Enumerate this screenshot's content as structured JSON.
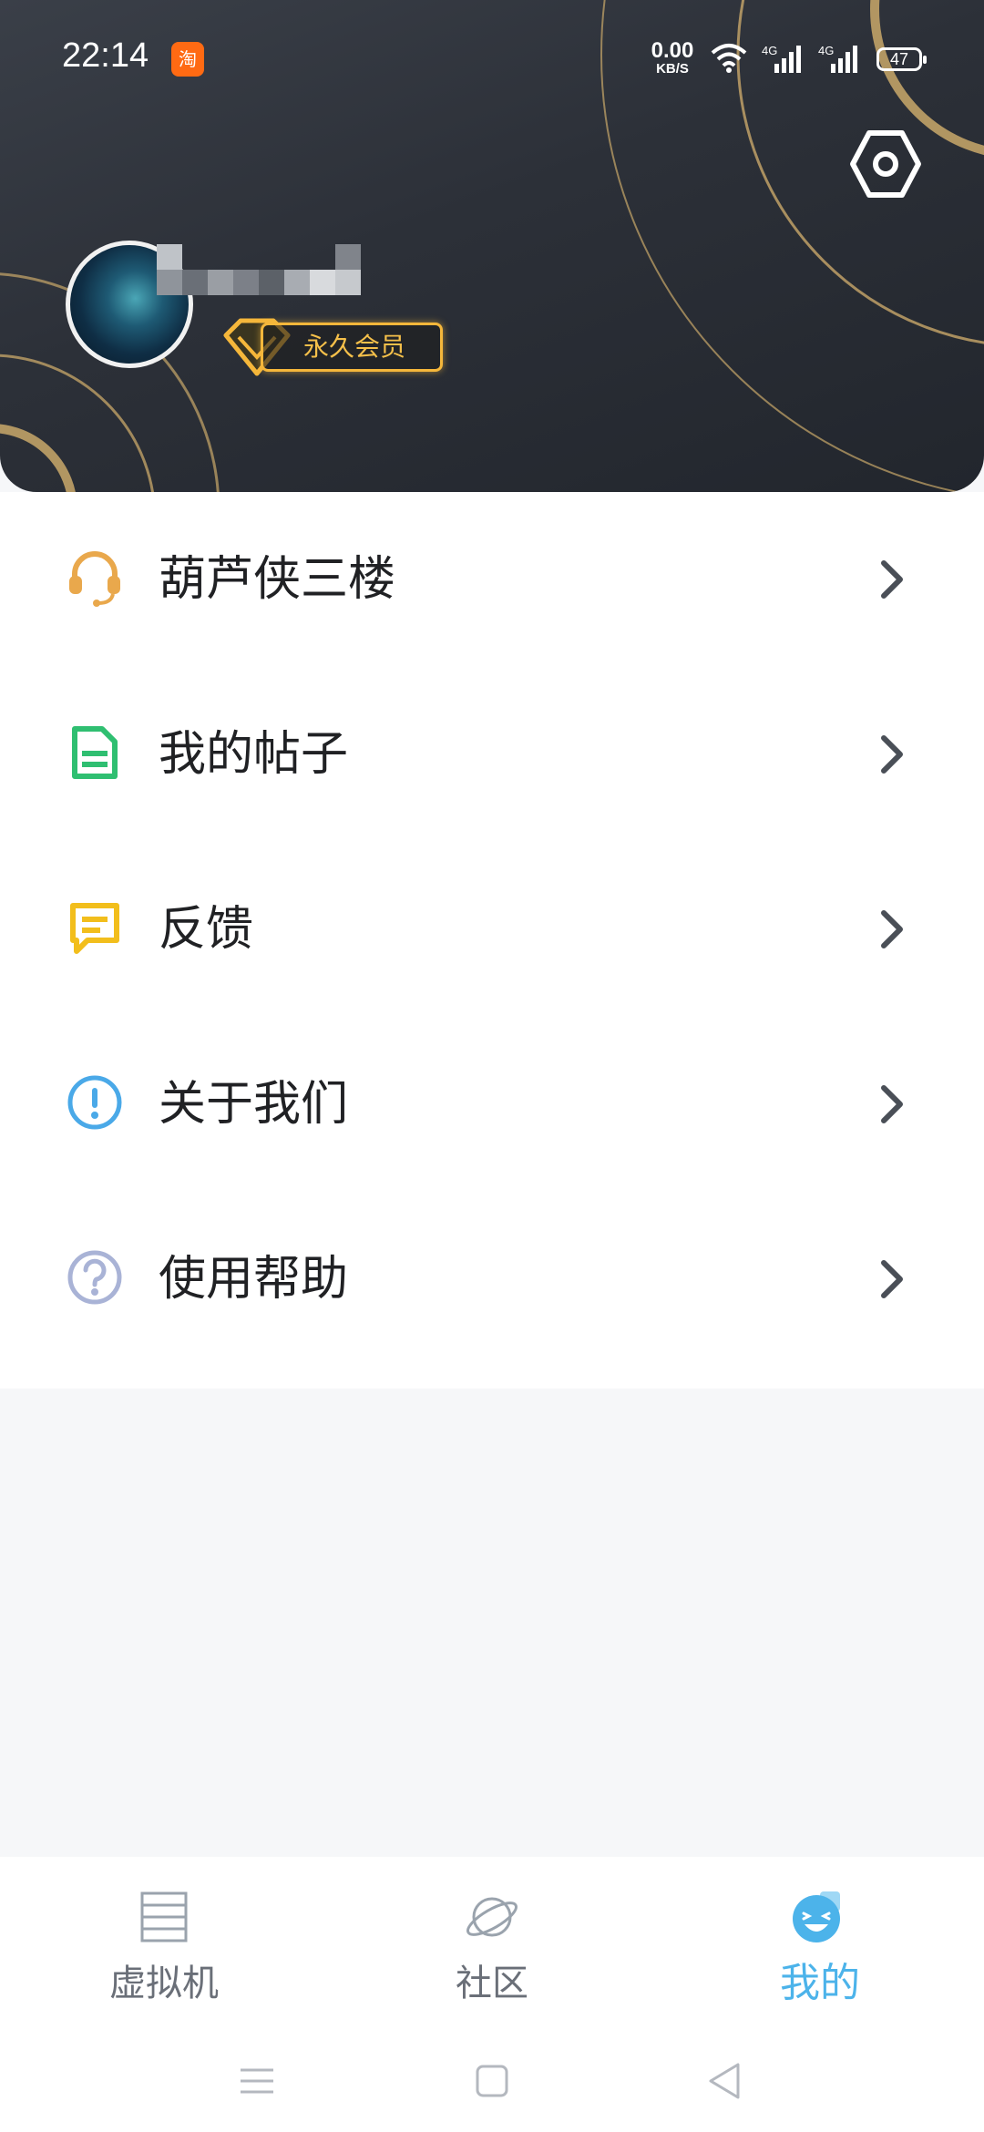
{
  "status_bar": {
    "time": "22:14",
    "app_badge": "淘",
    "net_speed_value": "0.00",
    "net_speed_unit": "KB/S",
    "signal_1": "4G",
    "signal_2": "4G",
    "battery": "47"
  },
  "profile": {
    "vip_label": "永久会员"
  },
  "menu": {
    "items": [
      {
        "label": "葫芦侠三楼",
        "icon": "headset-icon",
        "color": "#e9a84c"
      },
      {
        "label": "我的帖子",
        "icon": "document-icon",
        "color": "#2fbf71"
      },
      {
        "label": "反馈",
        "icon": "message-icon",
        "color": "#f2be1c"
      },
      {
        "label": "关于我们",
        "icon": "info-icon",
        "color": "#4aa9e8"
      },
      {
        "label": "使用帮助",
        "icon": "help-icon",
        "color": "#a9b3d6"
      }
    ]
  },
  "bottom_nav": {
    "items": [
      {
        "label": "虚拟机",
        "icon": "server-icon"
      },
      {
        "label": "社区",
        "icon": "planet-icon"
      },
      {
        "label": "我的",
        "icon": "smile-icon",
        "active": true
      }
    ]
  },
  "colors": {
    "accent": "#4cb3ea",
    "vip_gold": "#f5b73b",
    "header_bg": "#2c3038"
  }
}
